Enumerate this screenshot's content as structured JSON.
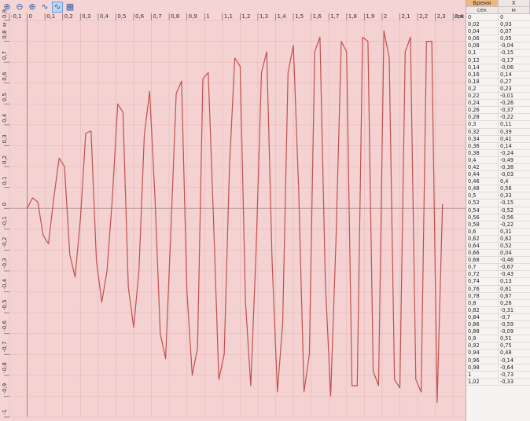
{
  "toolbar": {
    "tools": [
      {
        "name": "zoom-fit-icon",
        "glyph": "⊕"
      },
      {
        "name": "zoom-out-icon",
        "glyph": "⊖"
      },
      {
        "name": "zoom-in-icon",
        "glyph": "⊕"
      },
      {
        "name": "line-mode-icon",
        "glyph": "∿"
      },
      {
        "name": "curve-mode-icon",
        "glyph": "∿"
      },
      {
        "name": "grid-icon",
        "glyph": "▦"
      }
    ]
  },
  "chart_data": {
    "type": "line",
    "x_unit": "сек",
    "y_unit": "м",
    "x_ticks": [
      "-0,1",
      "0",
      "0,1",
      "0,2",
      "0,3",
      "0,4",
      "0,5",
      "0,6",
      "0,7",
      "0,8",
      "0,9",
      "1",
      "1,1",
      "1,2",
      "1,3",
      "1,4",
      "1,5",
      "1,6",
      "1,7",
      "1,8",
      "1,9",
      "2",
      "2,1",
      "2,2",
      "2,3",
      "2,4"
    ],
    "y_ticks": [
      "0,9",
      "0,8",
      "0,7",
      "0,6",
      "0,5",
      "0,4",
      "0,3",
      "0,2",
      "0,1",
      "0",
      "-0,1",
      "-0,2",
      "-0,3",
      "-0,4",
      "-0,5",
      "-0,6",
      "-0,7",
      "-0,8",
      "-0,9",
      "-1"
    ],
    "xlim": [
      -0.1,
      2.47
    ],
    "ylim": [
      -1.0,
      0.9
    ],
    "line_color": "#c0504d",
    "grid": true,
    "series": [
      {
        "x": [
          0,
          0.03,
          0.06,
          0.09,
          0.12,
          0.15,
          0.18,
          0.21,
          0.24,
          0.27,
          0.3,
          0.33,
          0.36,
          0.39,
          0.42,
          0.45,
          0.48,
          0.51,
          0.54,
          0.57,
          0.6,
          0.63,
          0.66,
          0.69,
          0.72,
          0.75,
          0.78,
          0.81,
          0.84,
          0.87,
          0.9,
          0.93,
          0.96,
          0.99,
          1.02,
          1.05,
          1.08,
          1.11,
          1.14,
          1.17,
          1.2,
          1.23,
          1.26,
          1.29,
          1.32,
          1.35,
          1.38,
          1.41,
          1.44,
          1.47,
          1.5,
          1.53,
          1.56,
          1.59,
          1.62,
          1.65,
          1.68,
          1.71,
          1.74,
          1.77,
          1.8,
          1.83,
          1.86,
          1.89,
          1.92,
          1.95,
          1.98,
          2.01,
          2.04,
          2.07,
          2.1,
          2.13,
          2.16,
          2.19,
          2.22,
          2.25,
          2.28,
          2.31,
          2.34
        ],
        "y": [
          0,
          0.05,
          0.03,
          -0.13,
          -0.17,
          0.05,
          0.24,
          0.2,
          -0.22,
          -0.33,
          -0.05,
          0.36,
          0.37,
          -0.25,
          -0.45,
          -0.3,
          0.05,
          0.5,
          0.46,
          -0.38,
          -0.57,
          -0.3,
          0.35,
          0.56,
          0.05,
          -0.6,
          -0.72,
          -0.1,
          0.55,
          0.61,
          -0.4,
          -0.8,
          -0.67,
          0.62,
          0.65,
          -0.05,
          -0.82,
          -0.7,
          0.2,
          0.72,
          0.68,
          -0.45,
          -0.85,
          -0.2,
          0.65,
          0.75,
          -0.25,
          -0.88,
          -0.55,
          0.65,
          0.78,
          0.08,
          -0.88,
          -0.7,
          0.75,
          0.82,
          -0.35,
          -0.9,
          -0.15,
          0.8,
          0.75,
          -0.85,
          -0.85,
          0.82,
          0.8,
          -0.78,
          -0.85,
          0.85,
          0.72,
          -0.82,
          -0.86,
          0.75,
          0.82,
          -0.82,
          -0.88,
          0.8,
          0.8,
          -0.93,
          0.02
        ]
      }
    ]
  },
  "table": {
    "headers": {
      "time": "Время",
      "x": "X"
    },
    "units": {
      "time": "сек",
      "x": "м"
    },
    "rows": [
      [
        "0",
        "0"
      ],
      [
        "0,02",
        "0,03"
      ],
      [
        "0,04",
        "0,07"
      ],
      [
        "0,06",
        "0,05"
      ],
      [
        "0,08",
        "-0,04"
      ],
      [
        "0,1",
        "-0,15"
      ],
      [
        "0,12",
        "-0,17"
      ],
      [
        "0,14",
        "-0,06"
      ],
      [
        "0,16",
        "0,14"
      ],
      [
        "0,18",
        "0,27"
      ],
      [
        "0,2",
        "0,23"
      ],
      [
        "0,22",
        "-0,01"
      ],
      [
        "0,24",
        "-0,26"
      ],
      [
        "0,26",
        "-0,37"
      ],
      [
        "0,28",
        "-0,22"
      ],
      [
        "0,3",
        "0,11"
      ],
      [
        "0,32",
        "0,39"
      ],
      [
        "0,34",
        "0,41"
      ],
      [
        "0,36",
        "0,14"
      ],
      [
        "0,38",
        "-0,24"
      ],
      [
        "0,4",
        "-0,49"
      ],
      [
        "0,42",
        "-0,38"
      ],
      [
        "0,44",
        "-0,03"
      ],
      [
        "0,46",
        "0,4"
      ],
      [
        "0,48",
        "0,56"
      ],
      [
        "0,5",
        "0,33"
      ],
      [
        "0,52",
        "-0,15"
      ],
      [
        "0,54",
        "-0,52"
      ],
      [
        "0,56",
        "-0,56"
      ],
      [
        "0,58",
        "-0,22"
      ],
      [
        "0,6",
        "0,31"
      ],
      [
        "0,62",
        "0,62"
      ],
      [
        "0,64",
        "0,52"
      ],
      [
        "0,66",
        "0,04"
      ],
      [
        "0,68",
        "-0,46"
      ],
      [
        "0,7",
        "-0,67"
      ],
      [
        "0,72",
        "-0,43"
      ],
      [
        "0,74",
        "0,13"
      ],
      [
        "0,76",
        "0,61"
      ],
      [
        "0,78",
        "0,67"
      ],
      [
        "0,8",
        "0,26"
      ],
      [
        "0,82",
        "-0,31"
      ],
      [
        "0,84",
        "-0,7"
      ],
      [
        "0,86",
        "-0,59"
      ],
      [
        "0,88",
        "-0,09"
      ],
      [
        "0,9",
        "0,51"
      ],
      [
        "0,92",
        "0,75"
      ],
      [
        "0,94",
        "0,48"
      ],
      [
        "0,96",
        "-0,14"
      ],
      [
        "0,98",
        "-0,64"
      ],
      [
        "1",
        "-0,73"
      ],
      [
        "1,02",
        "-0,33"
      ]
    ]
  }
}
